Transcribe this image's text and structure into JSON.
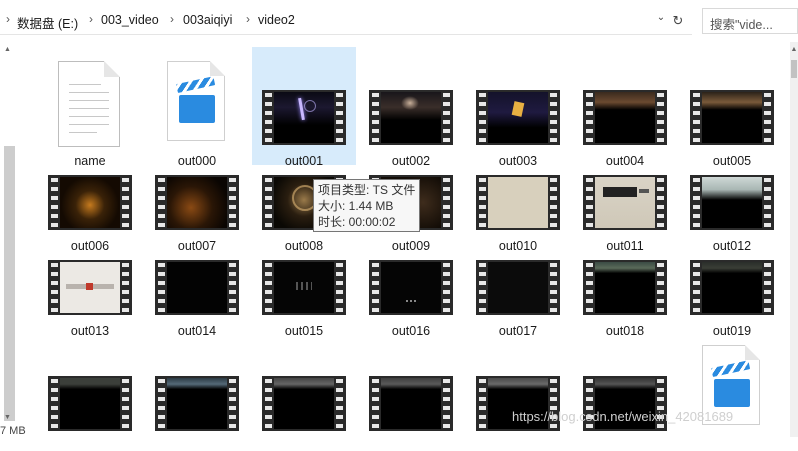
{
  "address_bar": {
    "breadcrumbs": [
      "数据盘 (E:)",
      "003_video",
      "003aiqiyi",
      "video2"
    ],
    "search_placeholder": "搜索\"vide..."
  },
  "items": [
    {
      "name": "name",
      "kind": "document",
      "selected": false
    },
    {
      "name": "out000",
      "kind": "video-icon",
      "selected": false
    },
    {
      "name": "out001",
      "kind": "video-thumb",
      "selected": true
    },
    {
      "name": "out002",
      "kind": "video-thumb",
      "selected": false
    },
    {
      "name": "out003",
      "kind": "video-thumb",
      "selected": false
    },
    {
      "name": "out004",
      "kind": "video-thumb",
      "selected": false
    },
    {
      "name": "out005",
      "kind": "video-thumb",
      "selected": false
    },
    {
      "name": "out006",
      "kind": "video-thumb",
      "selected": false
    },
    {
      "name": "out007",
      "kind": "video-thumb",
      "selected": false
    },
    {
      "name": "out008",
      "kind": "video-thumb",
      "selected": false
    },
    {
      "name": "out009",
      "kind": "video-thumb",
      "selected": false
    },
    {
      "name": "out010",
      "kind": "video-thumb",
      "selected": false
    },
    {
      "name": "out011",
      "kind": "video-thumb",
      "selected": false
    },
    {
      "name": "out012",
      "kind": "video-thumb",
      "selected": false
    },
    {
      "name": "out013",
      "kind": "video-thumb",
      "selected": false
    },
    {
      "name": "out014",
      "kind": "video-thumb",
      "selected": false
    },
    {
      "name": "out015",
      "kind": "video-thumb",
      "selected": false
    },
    {
      "name": "out016",
      "kind": "video-thumb",
      "selected": false
    },
    {
      "name": "out017",
      "kind": "video-thumb",
      "selected": false
    },
    {
      "name": "out018",
      "kind": "video-thumb",
      "selected": false
    },
    {
      "name": "out019",
      "kind": "video-thumb",
      "selected": false
    }
  ],
  "tooltip": {
    "type_line": "项目类型: TS 文件",
    "size_line": "大小: 1.44 MB",
    "duration_line": "时长: 00:00:02"
  },
  "status_bar": {
    "size_text": "7 MB"
  },
  "watermark": "https://blog.csdn.net/weixin_42081689",
  "colors": {
    "selection": "#d7ebfb",
    "video_icon_blue": "#2a8be0",
    "film_strip": "#2a2a2a"
  }
}
